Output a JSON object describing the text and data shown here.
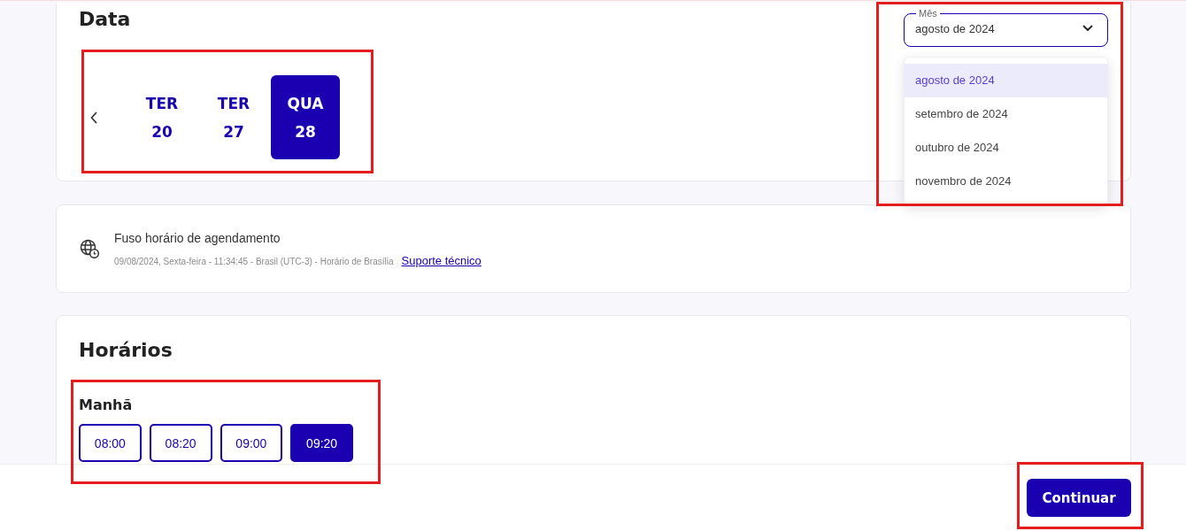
{
  "date_section": {
    "title": "Data",
    "highlighted": true,
    "month_select": {
      "label": "Mês",
      "value": "agosto de 2024",
      "expanded": true,
      "highlighted": true,
      "options": [
        {
          "label": "agosto de 2024",
          "selected": true
        },
        {
          "label": "setembro de 2024",
          "selected": false
        },
        {
          "label": "outubro de 2024",
          "selected": false
        },
        {
          "label": "novembro de 2024",
          "selected": false
        }
      ]
    },
    "days": [
      {
        "weekday": "TER",
        "day": "20",
        "selected": false
      },
      {
        "weekday": "TER",
        "day": "27",
        "selected": false
      },
      {
        "weekday": "QUA",
        "day": "28",
        "selected": true
      }
    ]
  },
  "timezone": {
    "title": "Fuso horário de agendamento",
    "details": "09/08/2024, Sexta-feira - 11:34:45 - Brasil (UTC-3) - Horário de Brasília",
    "link": "Suporte técnico"
  },
  "schedule": {
    "title": "Horários",
    "periods": [
      {
        "title": "Manhã",
        "highlighted": true,
        "slots": [
          {
            "time": "08:00",
            "selected": false
          },
          {
            "time": "08:20",
            "selected": false
          },
          {
            "time": "09:00",
            "selected": false
          },
          {
            "time": "09:20",
            "selected": true
          }
        ]
      }
    ]
  },
  "footer": {
    "continue_button": {
      "label": "Continuar",
      "highlighted": true
    }
  }
}
